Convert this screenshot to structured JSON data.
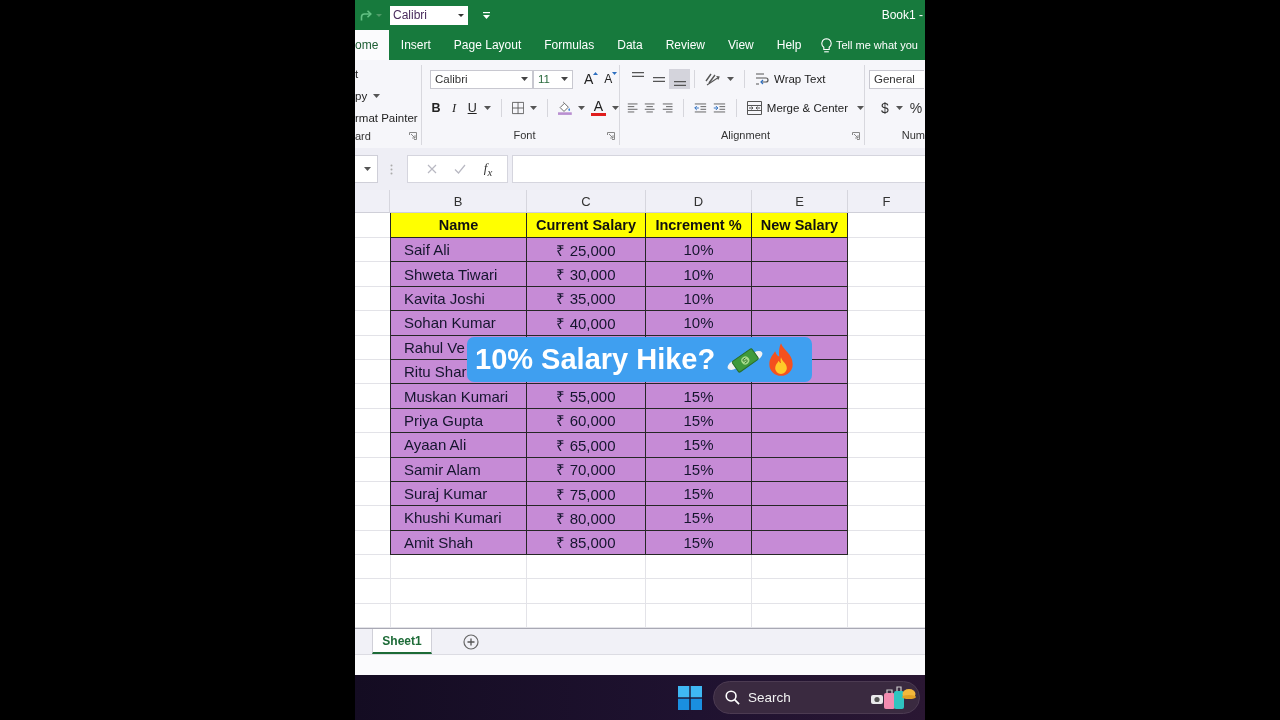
{
  "title_bar": {
    "quick_font": "Calibri",
    "title": "Book1 -"
  },
  "tabs": [
    {
      "label": "ome",
      "selected": true
    },
    {
      "label": "Insert",
      "selected": false
    },
    {
      "label": "Page Layout",
      "selected": false
    },
    {
      "label": "Formulas",
      "selected": false
    },
    {
      "label": "Data",
      "selected": false
    },
    {
      "label": "Review",
      "selected": false
    },
    {
      "label": "View",
      "selected": false
    },
    {
      "label": "Help",
      "selected": false
    }
  ],
  "tell_me": "Tell me what you",
  "ribbon": {
    "clipboard": {
      "items": [
        {
          "label": "t",
          "menu": false
        },
        {
          "label": "py",
          "menu": true
        },
        {
          "label": "rmat Painter",
          "menu": false
        }
      ],
      "label": "ard"
    },
    "font": {
      "font_name": "Calibri",
      "font_size": "11",
      "grow": "A",
      "shrink": "A",
      "bold": "B",
      "italic": "I",
      "underline": "U",
      "font_color": "A",
      "label": "Font"
    },
    "alignment": {
      "vertical": [
        {
          "selected": false
        },
        {
          "selected": false
        },
        {
          "selected": true
        }
      ],
      "wrap_text": "Wrap Text",
      "merge": "Merge & Center",
      "label": "Alignment"
    },
    "number": {
      "format": "General",
      "currency": "$",
      "percent": "%",
      "label": "Num"
    }
  },
  "formula_bar": {
    "function_label": "f$_{x}$",
    "edit_buttons_disabled": true
  },
  "columns": [
    "B",
    "C",
    "D",
    "E",
    "F"
  ],
  "table": {
    "header": [
      "Name",
      "Current Salary",
      "Increment %",
      "New Salary"
    ],
    "rows": [
      {
        "name": "Saif Ali",
        "current_salary": "₹ 25,000",
        "increment": "10%"
      },
      {
        "name": "Shweta Tiwari",
        "current_salary": "₹ 30,000",
        "increment": "10%"
      },
      {
        "name": "Kavita Joshi",
        "current_salary": "₹ 35,000",
        "increment": "10%"
      },
      {
        "name": "Sohan Kumar",
        "current_salary": "₹ 40,000",
        "increment": "10%"
      },
      {
        "name": "Rahul Ve"
      },
      {
        "name": "Ritu Shar"
      },
      {
        "name": "Muskan Kumari",
        "current_salary": "₹ 55,000",
        "increment": "15%"
      },
      {
        "name": "Priya Gupta",
        "current_salary": "₹ 60,000",
        "increment": "15%"
      },
      {
        "name": "Ayaan Ali",
        "current_salary": "₹ 65,000",
        "increment": "15%"
      },
      {
        "name": "Samir Alam",
        "current_salary": "₹ 70,000",
        "increment": "15%"
      },
      {
        "name": "Suraj Kumar",
        "current_salary": "₹ 75,000",
        "increment": "15%"
      },
      {
        "name": "Khushi Kumari",
        "current_salary": "₹ 80,000",
        "increment": "15%"
      },
      {
        "name": "Amit Shah",
        "current_salary": "₹ 85,000",
        "increment": "15%"
      }
    ]
  },
  "overlay": {
    "caption": "10% Salary Hike?"
  },
  "sheet_tabs": [
    {
      "label": "Sheet1",
      "selected": true
    }
  ],
  "taskbar": {
    "search_placeholder": "Search"
  }
}
